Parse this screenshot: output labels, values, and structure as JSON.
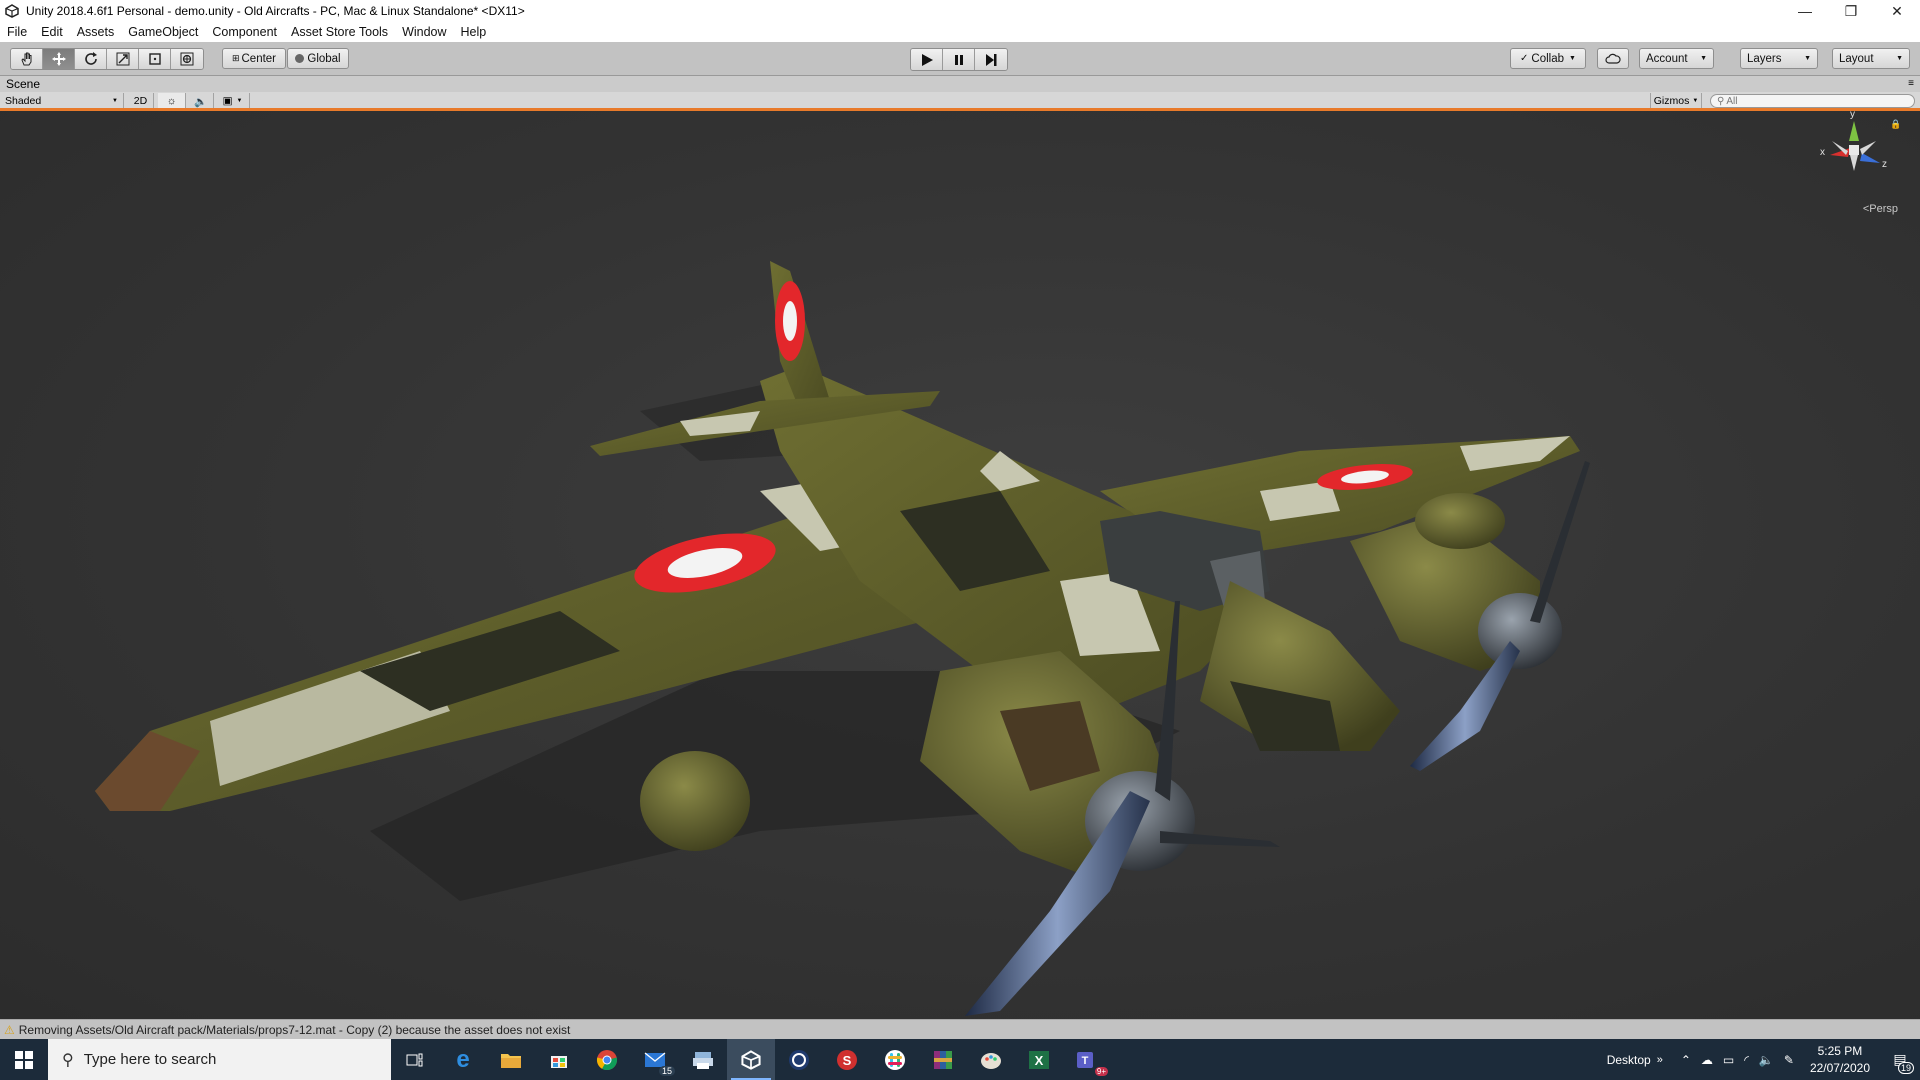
{
  "window": {
    "title": "Unity 2018.4.6f1 Personal - demo.unity - Old Aircrafts - PC, Mac & Linux Standalone* <DX11>",
    "minimize": "—",
    "restore": "❐",
    "close": "✕"
  },
  "menu": [
    "File",
    "Edit",
    "Assets",
    "GameObject",
    "Component",
    "Asset Store Tools",
    "Window",
    "Help"
  ],
  "toolbar": {
    "pivot_label": "Center",
    "space_label": "Global",
    "collab_label": "Collab",
    "account_label": "Account",
    "layers_label": "Layers",
    "layout_label": "Layout"
  },
  "scene": {
    "tab_label": "Scene",
    "draw_mode": "Shaded",
    "mode_2d": "2D",
    "gizmos_label": "Gizmos",
    "search_placeholder": "All",
    "persp_label": "Persp",
    "axis_x": "x",
    "axis_y": "y",
    "axis_z": "z"
  },
  "status": {
    "message": "Removing Assets/Old Aircraft pack/Materials/props7-12.mat - Copy (2) because the asset does not exist"
  },
  "taskbar": {
    "search_placeholder": "Type here to search",
    "mail_badge": "15",
    "desktop_label": "Desktop",
    "time": "5:25 PM",
    "date": "22/07/2020",
    "notif_count": "19",
    "teams_badge": "9+"
  }
}
